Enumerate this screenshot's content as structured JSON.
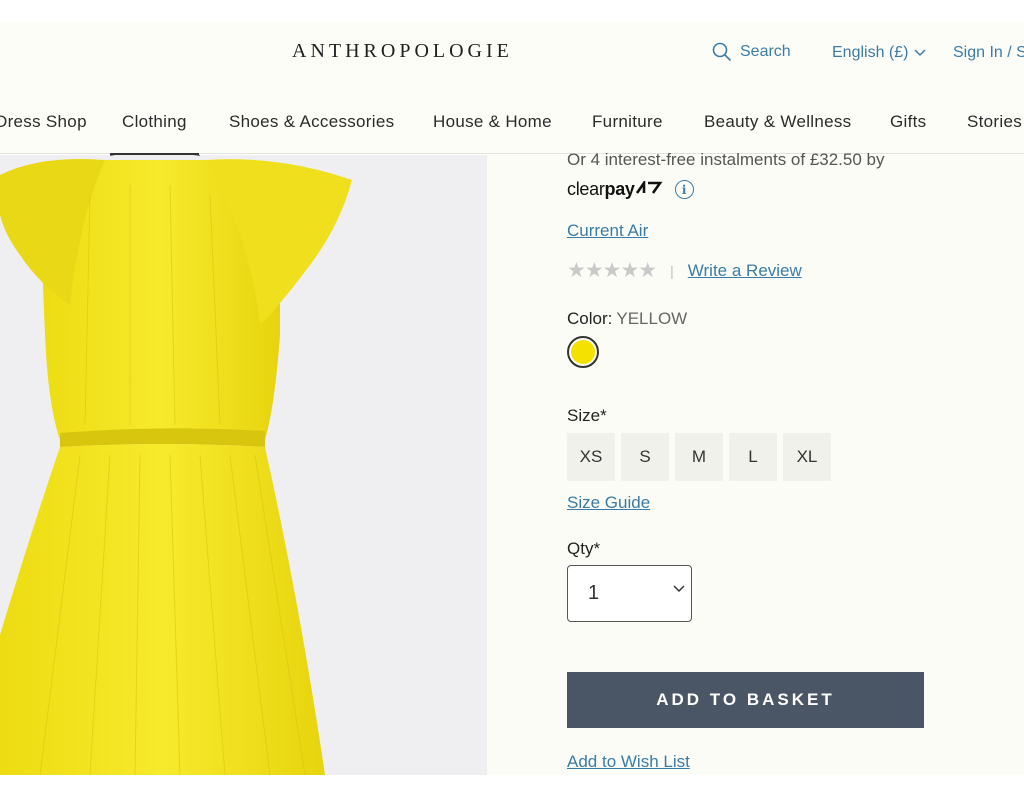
{
  "header": {
    "logo": "ANTHROPOLOGIE",
    "search_label": "Search",
    "language_label": "English (£)",
    "signin_label": "Sign In / S"
  },
  "nav": {
    "items": [
      {
        "label": "Dress Shop"
      },
      {
        "label": "Clothing"
      },
      {
        "label": "Shoes & Accessories"
      },
      {
        "label": "House & Home"
      },
      {
        "label": "Furniture"
      },
      {
        "label": "Beauty & Wellness"
      },
      {
        "label": "Gifts"
      },
      {
        "label": "Stories"
      }
    ],
    "active": "Clothing"
  },
  "product": {
    "instalments_text": "Or 4 interest-free instalments of £32.50 by",
    "clearpay_prefix": "clear",
    "clearpay_bold": "pay",
    "info_icon": "i",
    "brand": "Current Air",
    "rating": {
      "stars": "★★★★★",
      "value": 0,
      "max": 5,
      "separator": "|",
      "review_link": "Write a Review"
    },
    "color_label": "Color:",
    "color_value": "YELLOW",
    "swatch_color": "#f4e100",
    "size_label": "Size*",
    "sizes": [
      "XS",
      "S",
      "M",
      "L",
      "XL"
    ],
    "size_guide": "Size Guide",
    "qty_label": "Qty*",
    "qty_value": "1",
    "add_to_basket": "ADD TO BASKET",
    "wish_list": "Add to Wish List"
  },
  "colors": {
    "link": "#3a7ca5",
    "basket_button": "#4a5566",
    "dress": "#f2e31e"
  }
}
